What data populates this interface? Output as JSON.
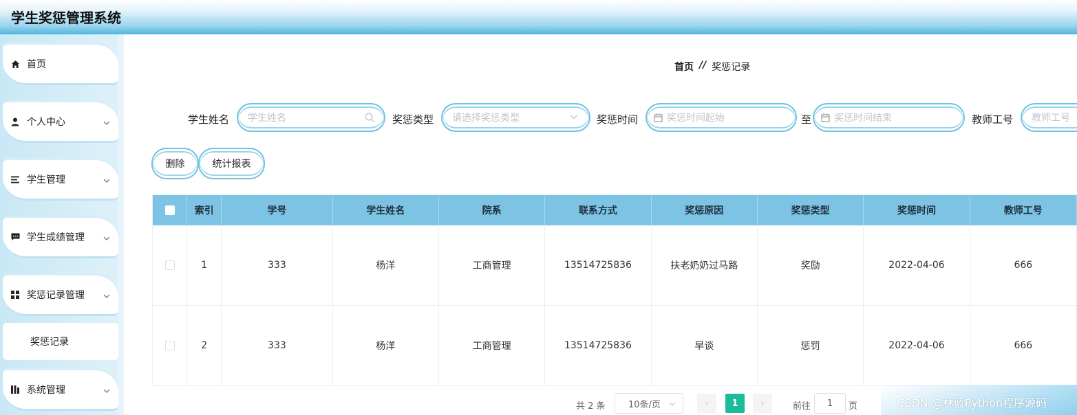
{
  "app": {
    "title": "学生奖惩管理系统"
  },
  "sidebar": {
    "items": [
      {
        "label": "首页",
        "icon": "home-icon",
        "has_arrow": false
      },
      {
        "label": "个人中心",
        "icon": "user-icon",
        "has_arrow": true
      },
      {
        "label": "学生管理",
        "icon": "list-icon",
        "has_arrow": true
      },
      {
        "label": "学生成绩管理",
        "icon": "comment-icon",
        "has_arrow": true
      },
      {
        "label": "奖惩记录管理",
        "icon": "grid-icon",
        "has_arrow": true
      },
      {
        "label": "系统管理",
        "icon": "bar-chart-icon",
        "has_arrow": true
      }
    ],
    "subitem": {
      "label": "奖惩记录"
    }
  },
  "breadcrumb": {
    "home": "首页",
    "separator": "//",
    "current": "奖惩记录"
  },
  "search": {
    "student_name": {
      "label": "学生姓名",
      "placeholder": "学生姓名"
    },
    "type": {
      "label": "奖惩类型",
      "placeholder": "请选择奖惩类型"
    },
    "time": {
      "label": "奖惩时间",
      "start_placeholder": "奖惩时间起始",
      "end_placeholder": "奖惩时间结束",
      "to": "至"
    },
    "teacher_id": {
      "label": "教师工号",
      "placeholder": "教师工号"
    }
  },
  "toolbar": {
    "delete_label": "删除",
    "report_label": "统计报表"
  },
  "table": {
    "headers": [
      "索引",
      "学号",
      "学生姓名",
      "院系",
      "联系方式",
      "奖惩原因",
      "奖惩类型",
      "奖惩时间",
      "教师工号"
    ],
    "rows": [
      [
        "1",
        "333",
        "杨洋",
        "工商管理",
        "13514725836",
        "扶老奶奶过马路",
        "奖励",
        "2022-04-06",
        "666"
      ],
      [
        "2",
        "333",
        "杨洋",
        "工商管理",
        "13514725836",
        "早谈",
        "惩罚",
        "2022-04-06",
        "666"
      ]
    ]
  },
  "pagination": {
    "total": "共 2 条",
    "page_size": "10条/页",
    "prev": "‹",
    "current": "1",
    "next": "›",
    "goto_label": "前往",
    "goto_value": "1",
    "unit": "页"
  },
  "watermark": "CSDN @林蓝Python程序源码",
  "colors": {
    "header_accent": "#4fb6e0",
    "table_header": "#7dc4e4",
    "page_active": "#1bbc9b",
    "input_border": "#6ec3e3"
  }
}
